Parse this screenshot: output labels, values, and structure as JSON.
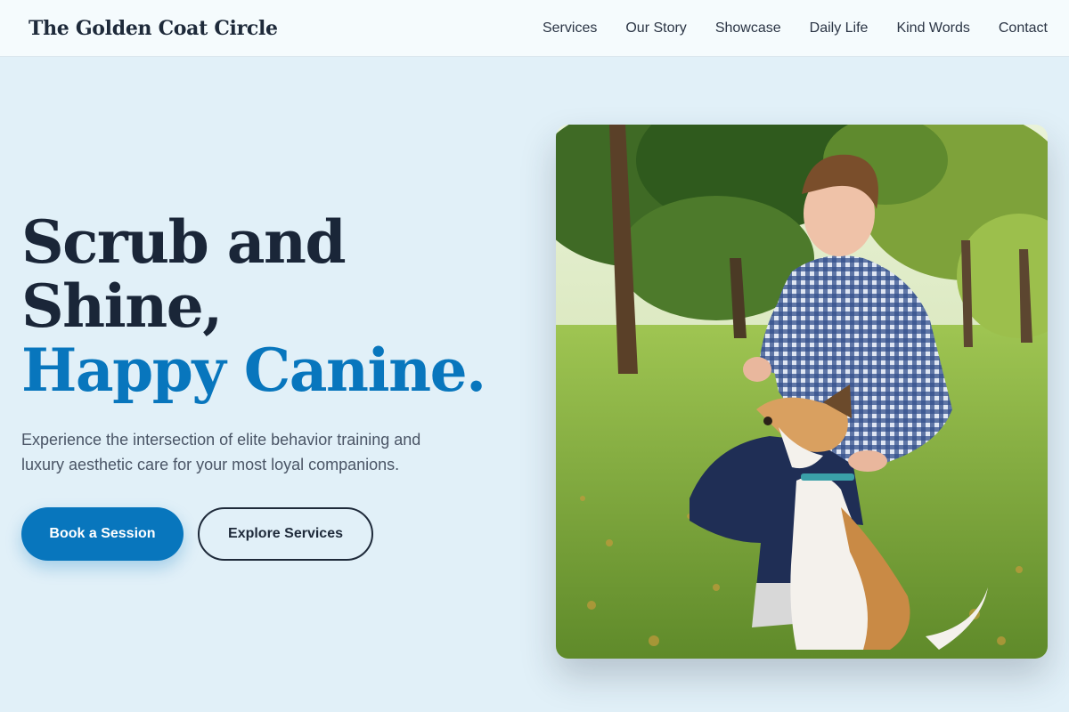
{
  "header": {
    "brand": "The Golden Coat Circle",
    "nav": [
      "Services",
      "Our Story",
      "Showcase",
      "Daily Life",
      "Kind Words",
      "Contact"
    ]
  },
  "hero": {
    "headline_line1": "Scrub and",
    "headline_line2": "Shine,",
    "headline_accent": "Happy Canine.",
    "lead": "Experience the intersection of elite behavior training and luxury aesthetic care for your most loyal companions.",
    "primary_cta": "Book a Session",
    "secondary_cta": "Explore Services"
  },
  "colors": {
    "background": "#e1f0f8",
    "accent": "#0876bd",
    "text": "#1e2a3a"
  }
}
